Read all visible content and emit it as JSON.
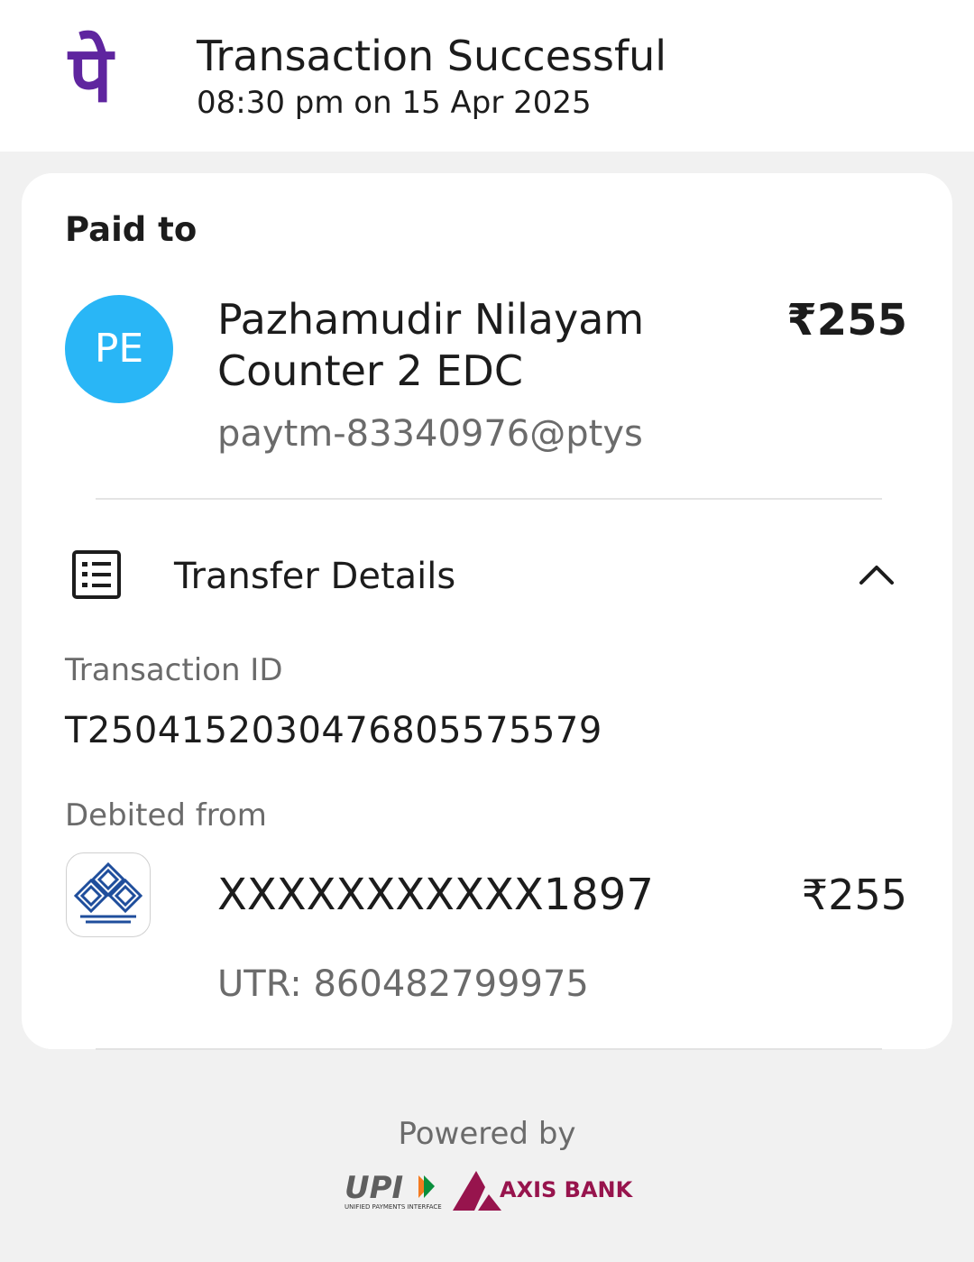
{
  "header": {
    "logo_glyph": "पे",
    "title": "Transaction Successful",
    "datetime": "08:30 pm on 15 Apr 2025",
    "brand_color": "#5f259f"
  },
  "paid_to": {
    "label": "Paid to",
    "avatar_initials": "PE",
    "avatar_color": "#29b6f6",
    "name": "Pazhamudir Nilayam Counter 2 EDC",
    "amount": "₹255",
    "upi_id": "paytm-83340976@ptys"
  },
  "transfer_details": {
    "title": "Transfer Details",
    "icon": "receipt-list-icon",
    "toggle_icon": "chevron-up-icon",
    "transaction_id_label": "Transaction ID",
    "transaction_id": "T2504152030476805575579",
    "debited_from_label": "Debited from",
    "account": "XXXXXXXXXXX1897",
    "amount": "₹255",
    "utr": "UTR: 860482799975",
    "bank_icon": "bank-logo-icon"
  },
  "footer": {
    "powered_by": "Powered by",
    "upi_text": "UPI",
    "upi_tagline": "UNIFIED PAYMENTS INTERFACE",
    "bank_text": "AXIS BANK",
    "bank_color": "#97144d"
  }
}
